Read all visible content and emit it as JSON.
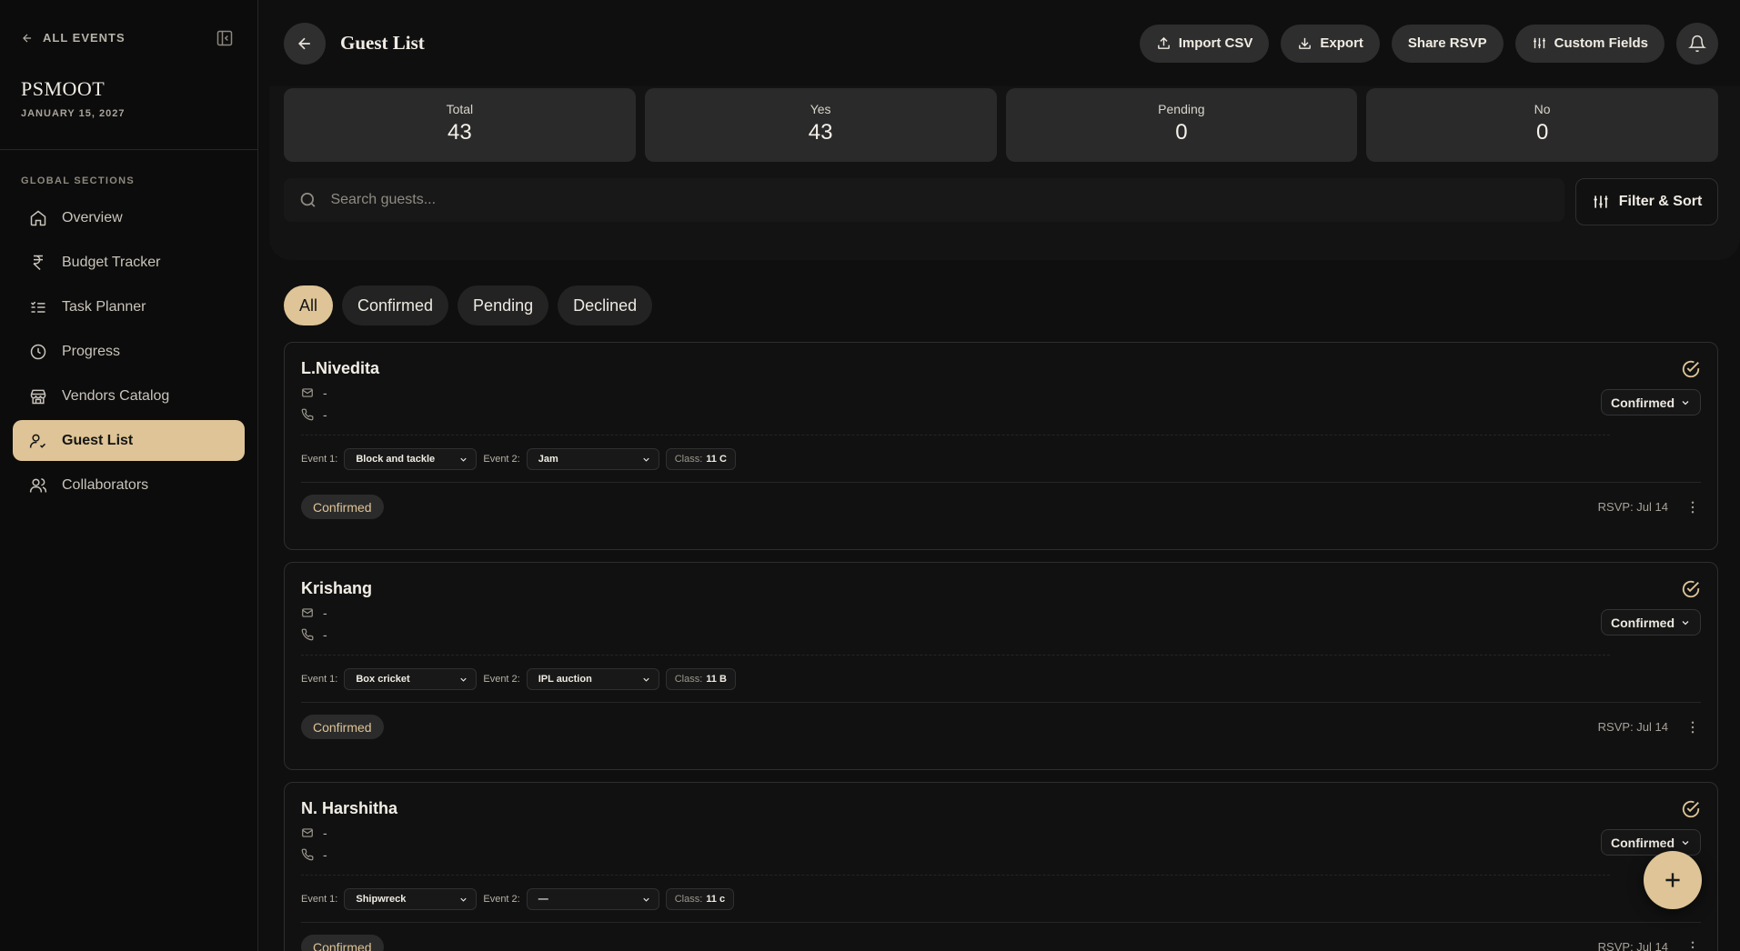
{
  "sidebar": {
    "back_label": "ALL EVENTS",
    "event_name": "PSMOOT",
    "event_date": "JANUARY 15, 2027",
    "section_title": "GLOBAL SECTIONS",
    "items": [
      {
        "label": "Overview",
        "icon": "home-icon"
      },
      {
        "label": "Budget Tracker",
        "icon": "rupee-icon"
      },
      {
        "label": "Task Planner",
        "icon": "list-check-icon"
      },
      {
        "label": "Progress",
        "icon": "clock-icon"
      },
      {
        "label": "Vendors Catalog",
        "icon": "store-icon"
      },
      {
        "label": "Guest List",
        "icon": "user-check-icon",
        "active": true
      },
      {
        "label": "Collaborators",
        "icon": "users-icon"
      }
    ]
  },
  "header": {
    "title": "Guest List",
    "import_label": "Import CSV",
    "export_label": "Export",
    "share_label": "Share RSVP",
    "custom_fields_label": "Custom Fields"
  },
  "stats": [
    {
      "label": "Total",
      "value": "43"
    },
    {
      "label": "Yes",
      "value": "43"
    },
    {
      "label": "Pending",
      "value": "0"
    },
    {
      "label": "No",
      "value": "0"
    }
  ],
  "search": {
    "placeholder": "Search guests...",
    "value": ""
  },
  "filter_label": "Filter & Sort",
  "tabs": [
    {
      "label": "All",
      "active": true
    },
    {
      "label": "Confirmed"
    },
    {
      "label": "Pending"
    },
    {
      "label": "Declined"
    }
  ],
  "guests": [
    {
      "name": "L.Nivedita",
      "email": "-",
      "phone": "-",
      "status": "Confirmed",
      "event1_label": "Event 1:",
      "event1": "Block and tackle",
      "event2_label": "Event 2:",
      "event2": "Jam",
      "class_label": "Class:",
      "class": "11 C",
      "badge": "Confirmed",
      "rsvp": "RSVP: Jul 14"
    },
    {
      "name": "Krishang",
      "email": "-",
      "phone": "-",
      "status": "Confirmed",
      "event1_label": "Event 1:",
      "event1": "Box cricket",
      "event2_label": "Event 2:",
      "event2": "IPL auction",
      "class_label": "Class:",
      "class": "11 B",
      "badge": "Confirmed",
      "rsvp": "RSVP: Jul 14"
    },
    {
      "name": "N. Harshitha",
      "email": "-",
      "phone": "-",
      "status": "Confirmed",
      "event1_label": "Event 1:",
      "event1": "Shipwreck",
      "event2_label": "Event 2:",
      "event2": "—",
      "class_label": "Class:",
      "class": "11 c",
      "badge": "Confirmed",
      "rsvp": "RSVP: Jul 14"
    }
  ],
  "colors": {
    "accent": "#dec496",
    "background": "#0f0f0f",
    "card": "#2a2a2a"
  }
}
